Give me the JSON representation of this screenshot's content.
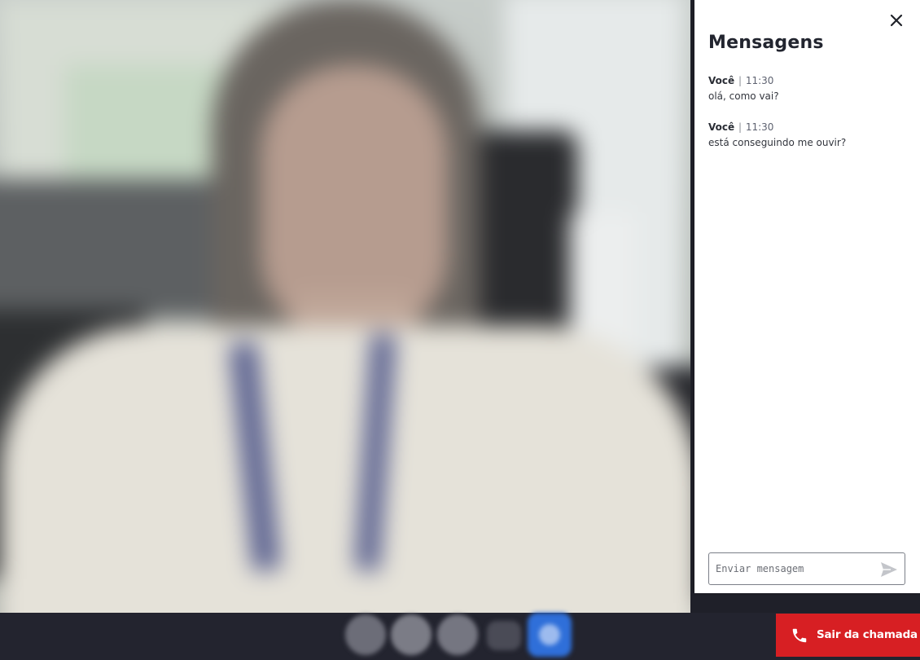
{
  "chat": {
    "title": "Mensagens",
    "close_icon": "close-icon",
    "messages": [
      {
        "author": "Você",
        "separator": "|",
        "time": "11:30",
        "text": "olá, como vai?"
      },
      {
        "author": "Você",
        "separator": "|",
        "time": "11:30",
        "text": "está conseguindo me ouvir?"
      }
    ],
    "composer": {
      "placeholder": "Enviar mensagem",
      "value": "",
      "send_icon": "send-icon"
    }
  },
  "controls": {
    "icons": [
      "control-button-icon",
      "control-button-icon",
      "control-button-icon",
      "control-button-icon",
      "chat-toggle-icon"
    ],
    "active_color": "#2f6fd9"
  },
  "leave_button": {
    "label": "Sair da chamada",
    "icon": "phone-icon",
    "color": "#d71f23"
  }
}
